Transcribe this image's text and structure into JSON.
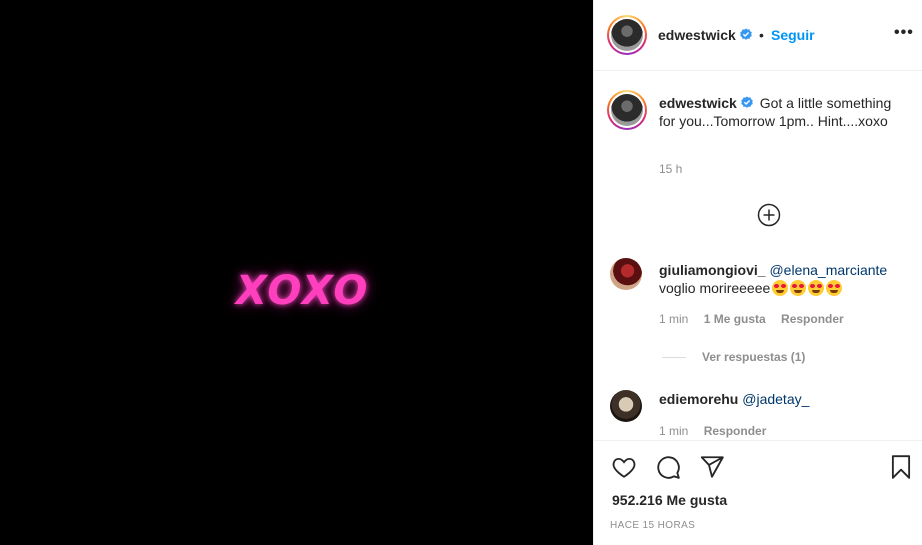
{
  "media": {
    "text": "XOXO",
    "accent": "#ff3fbd"
  },
  "header": {
    "username": "edwestwick",
    "separator": "•",
    "follow_label": "Seguir",
    "more_label": "•••"
  },
  "caption": {
    "username": "edwestwick",
    "text": "Got a little something for you...Tomorrow 1pm.. Hint....xoxo",
    "time": "15 h"
  },
  "comments": [
    {
      "username": "giuliamongiovi_",
      "mention": "@elena_marciante",
      "text": "voglio morireeeee",
      "emoji_count": 4,
      "time": "1 min",
      "likes": "1 Me gusta",
      "reply_label": "Responder",
      "view_replies": "Ver respuestas (1)"
    },
    {
      "username": "ediemorehu",
      "mention": "@jadetay_",
      "text": "",
      "time": "1 min",
      "reply_label": "Responder"
    }
  ],
  "actions": {
    "likes": "952.216 Me gusta",
    "timestamp": "HACE 15 HORAS"
  },
  "colors": {
    "link": "#0095f6",
    "mention": "#00376b",
    "muted": "#8e8e8e"
  },
  "icons": [
    "verified-badge-icon",
    "more-options-icon",
    "add-circle-icon",
    "heart-icon",
    "comment-icon",
    "share-icon",
    "bookmark-icon"
  ]
}
